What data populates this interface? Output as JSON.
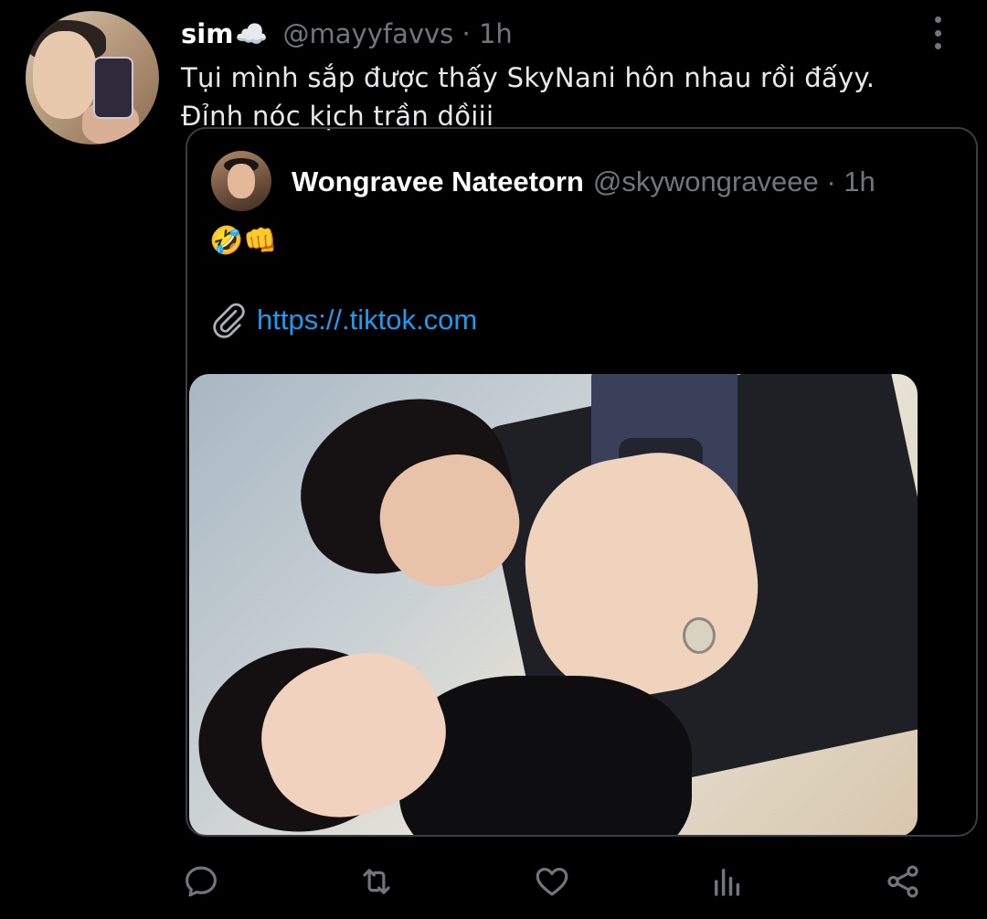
{
  "author": {
    "display_name": "sim",
    "name_emoji": "☁️",
    "handle_time": "@mayyfavvs · 1h"
  },
  "tweet": {
    "text_line1": "Tụi mình sắp được thấy SkyNani hôn nhau rồi đấyy.",
    "text_line2": "Đỉnh nóc kịch trần dồiii"
  },
  "quoted": {
    "display_name": "Wongravee Nateetorn",
    "handle_time": "@skywongraveee · 1h",
    "emojis": "🤣👊",
    "link": "https://.tiktok.com"
  },
  "icons": {
    "more": "more-vertical-icon",
    "paperclip": "paperclip-icon",
    "reply": "reply-icon",
    "retweet": "retweet-icon",
    "like": "heart-icon",
    "views": "views-icon",
    "share": "share-icon"
  },
  "colors": {
    "background": "#000000",
    "text": "#e7e9ea",
    "muted": "#71767b",
    "link": "#1d9bf0",
    "border": "#3a3d41"
  }
}
